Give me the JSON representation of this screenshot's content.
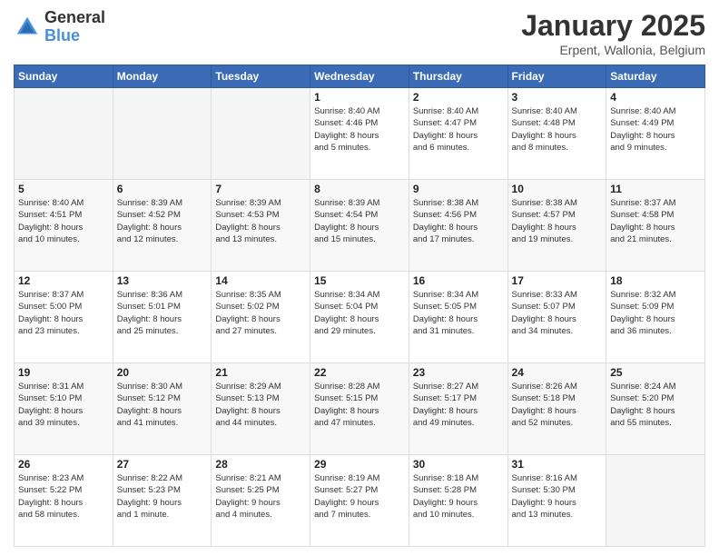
{
  "header": {
    "logo_general": "General",
    "logo_blue": "Blue",
    "month_title": "January 2025",
    "location": "Erpent, Wallonia, Belgium"
  },
  "days_of_week": [
    "Sunday",
    "Monday",
    "Tuesday",
    "Wednesday",
    "Thursday",
    "Friday",
    "Saturday"
  ],
  "weeks": [
    [
      {
        "day": "",
        "info": ""
      },
      {
        "day": "",
        "info": ""
      },
      {
        "day": "",
        "info": ""
      },
      {
        "day": "1",
        "info": "Sunrise: 8:40 AM\nSunset: 4:46 PM\nDaylight: 8 hours\nand 5 minutes."
      },
      {
        "day": "2",
        "info": "Sunrise: 8:40 AM\nSunset: 4:47 PM\nDaylight: 8 hours\nand 6 minutes."
      },
      {
        "day": "3",
        "info": "Sunrise: 8:40 AM\nSunset: 4:48 PM\nDaylight: 8 hours\nand 8 minutes."
      },
      {
        "day": "4",
        "info": "Sunrise: 8:40 AM\nSunset: 4:49 PM\nDaylight: 8 hours\nand 9 minutes."
      }
    ],
    [
      {
        "day": "5",
        "info": "Sunrise: 8:40 AM\nSunset: 4:51 PM\nDaylight: 8 hours\nand 10 minutes."
      },
      {
        "day": "6",
        "info": "Sunrise: 8:39 AM\nSunset: 4:52 PM\nDaylight: 8 hours\nand 12 minutes."
      },
      {
        "day": "7",
        "info": "Sunrise: 8:39 AM\nSunset: 4:53 PM\nDaylight: 8 hours\nand 13 minutes."
      },
      {
        "day": "8",
        "info": "Sunrise: 8:39 AM\nSunset: 4:54 PM\nDaylight: 8 hours\nand 15 minutes."
      },
      {
        "day": "9",
        "info": "Sunrise: 8:38 AM\nSunset: 4:56 PM\nDaylight: 8 hours\nand 17 minutes."
      },
      {
        "day": "10",
        "info": "Sunrise: 8:38 AM\nSunset: 4:57 PM\nDaylight: 8 hours\nand 19 minutes."
      },
      {
        "day": "11",
        "info": "Sunrise: 8:37 AM\nSunset: 4:58 PM\nDaylight: 8 hours\nand 21 minutes."
      }
    ],
    [
      {
        "day": "12",
        "info": "Sunrise: 8:37 AM\nSunset: 5:00 PM\nDaylight: 8 hours\nand 23 minutes."
      },
      {
        "day": "13",
        "info": "Sunrise: 8:36 AM\nSunset: 5:01 PM\nDaylight: 8 hours\nand 25 minutes."
      },
      {
        "day": "14",
        "info": "Sunrise: 8:35 AM\nSunset: 5:02 PM\nDaylight: 8 hours\nand 27 minutes."
      },
      {
        "day": "15",
        "info": "Sunrise: 8:34 AM\nSunset: 5:04 PM\nDaylight: 8 hours\nand 29 minutes."
      },
      {
        "day": "16",
        "info": "Sunrise: 8:34 AM\nSunset: 5:05 PM\nDaylight: 8 hours\nand 31 minutes."
      },
      {
        "day": "17",
        "info": "Sunrise: 8:33 AM\nSunset: 5:07 PM\nDaylight: 8 hours\nand 34 minutes."
      },
      {
        "day": "18",
        "info": "Sunrise: 8:32 AM\nSunset: 5:09 PM\nDaylight: 8 hours\nand 36 minutes."
      }
    ],
    [
      {
        "day": "19",
        "info": "Sunrise: 8:31 AM\nSunset: 5:10 PM\nDaylight: 8 hours\nand 39 minutes."
      },
      {
        "day": "20",
        "info": "Sunrise: 8:30 AM\nSunset: 5:12 PM\nDaylight: 8 hours\nand 41 minutes."
      },
      {
        "day": "21",
        "info": "Sunrise: 8:29 AM\nSunset: 5:13 PM\nDaylight: 8 hours\nand 44 minutes."
      },
      {
        "day": "22",
        "info": "Sunrise: 8:28 AM\nSunset: 5:15 PM\nDaylight: 8 hours\nand 47 minutes."
      },
      {
        "day": "23",
        "info": "Sunrise: 8:27 AM\nSunset: 5:17 PM\nDaylight: 8 hours\nand 49 minutes."
      },
      {
        "day": "24",
        "info": "Sunrise: 8:26 AM\nSunset: 5:18 PM\nDaylight: 8 hours\nand 52 minutes."
      },
      {
        "day": "25",
        "info": "Sunrise: 8:24 AM\nSunset: 5:20 PM\nDaylight: 8 hours\nand 55 minutes."
      }
    ],
    [
      {
        "day": "26",
        "info": "Sunrise: 8:23 AM\nSunset: 5:22 PM\nDaylight: 8 hours\nand 58 minutes."
      },
      {
        "day": "27",
        "info": "Sunrise: 8:22 AM\nSunset: 5:23 PM\nDaylight: 9 hours\nand 1 minute."
      },
      {
        "day": "28",
        "info": "Sunrise: 8:21 AM\nSunset: 5:25 PM\nDaylight: 9 hours\nand 4 minutes."
      },
      {
        "day": "29",
        "info": "Sunrise: 8:19 AM\nSunset: 5:27 PM\nDaylight: 9 hours\nand 7 minutes."
      },
      {
        "day": "30",
        "info": "Sunrise: 8:18 AM\nSunset: 5:28 PM\nDaylight: 9 hours\nand 10 minutes."
      },
      {
        "day": "31",
        "info": "Sunrise: 8:16 AM\nSunset: 5:30 PM\nDaylight: 9 hours\nand 13 minutes."
      },
      {
        "day": "",
        "info": ""
      }
    ]
  ]
}
